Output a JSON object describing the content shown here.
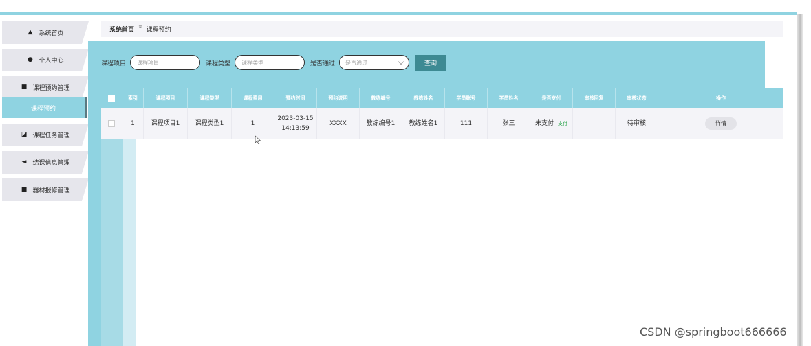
{
  "breadcrumb": {
    "home": "系统首页",
    "separator": "Ξ",
    "current": "课程预约"
  },
  "sidebar": {
    "items": [
      {
        "label": "系统首页",
        "icon": "home-icon"
      },
      {
        "label": "个人中心",
        "icon": "user-icon"
      },
      {
        "label": "课程预约管理",
        "icon": "monitor-icon"
      },
      {
        "label": "课程任务管理",
        "icon": "chart-icon"
      },
      {
        "label": "结课信息管理",
        "icon": "send-icon"
      },
      {
        "label": "器材报修管理",
        "icon": "monitor-icon"
      }
    ],
    "active_sub": "课程预约"
  },
  "search": {
    "project_label": "课程项目",
    "project_placeholder": "课程项目",
    "type_label": "课程类型",
    "type_placeholder": "课程类型",
    "approved_label": "是否通过",
    "approved_placeholder": "是否通过",
    "query_button": "查询"
  },
  "table": {
    "headers": [
      "",
      "索引",
      "课程项目",
      "课程类型",
      "课程费用",
      "预约时间",
      "预约说明",
      "教练编号",
      "教练姓名",
      "学员账号",
      "学员姓名",
      "是否支付",
      "审核回复",
      "审核状态",
      "操作"
    ],
    "rows": [
      {
        "index": "1",
        "project": "课程项目1",
        "type": "课程类型1",
        "fee": "1",
        "time_date": "2023-03-15",
        "time_clock": "14:13:59",
        "note": "XXXX",
        "coach_no": "教练编号1",
        "coach_name": "教练姓名1",
        "student_account": "111",
        "student_name": "张三",
        "paid": "未支付",
        "pay_action": "支付",
        "reply": "",
        "status": "待审核",
        "action": "详情"
      }
    ]
  },
  "watermark": "CSDN @springboot666666",
  "colors": {
    "accent": "#8fd3e1",
    "button": "#3d8a93",
    "pay_link": "#34a853",
    "sidebar_item": "#e6e6ec"
  }
}
